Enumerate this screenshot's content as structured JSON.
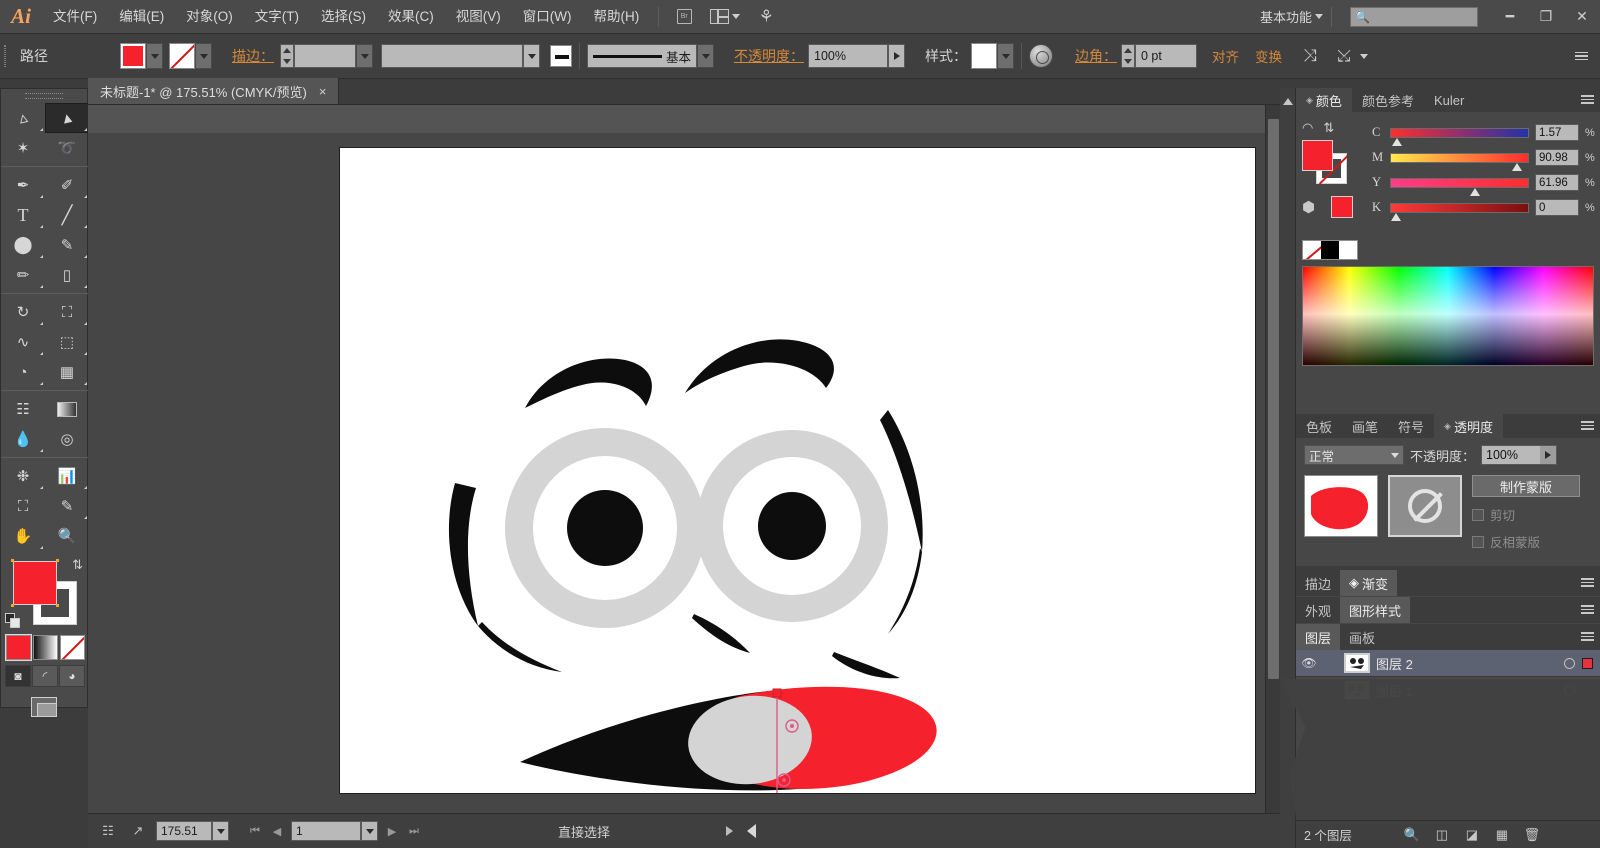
{
  "app": {
    "logo": "Ai",
    "menus": [
      "文件(F)",
      "编辑(E)",
      "对象(O)",
      "文字(T)",
      "选择(S)",
      "效果(C)",
      "视图(V)",
      "窗口(W)",
      "帮助(H)"
    ],
    "bridge_icon": "bridge-icon",
    "arrange_icon": "arrange-documents-icon",
    "workspace": "基本功能",
    "search_placeholder": "",
    "window_buttons": [
      "minimize",
      "restore",
      "close"
    ]
  },
  "control_bar": {
    "selection_label": "路径",
    "fill_label": "fill-swatch",
    "fill_color": "#f5222d",
    "stroke_label": "stroke-swatch",
    "stroke_value": "无",
    "stroke_text": "描边：",
    "stroke_weight": "",
    "stroke_profile": "",
    "brush_preview_name": "基本",
    "opacity_label": "不透明度：",
    "opacity_value": "100%",
    "style_label": "样式：",
    "recolor_icon": "recolor-artwork-icon",
    "corner_label": "边角：",
    "corner_value": "0 pt",
    "align_label": "对齐",
    "transform_label": "变换",
    "isolate_icon": "isolate-selected-icon",
    "hide_icon": "hide-icon",
    "panel_menu": "panel-menu-icon"
  },
  "document": {
    "tab_title": "未标题-1* @ 175.51% (CMYK/预览)",
    "close": "×"
  },
  "toolbox": {
    "tools": [
      {
        "name": "selection-tool",
        "glyph": "↖",
        "active": false
      },
      {
        "name": "direct-selection-tool",
        "glyph": "↖",
        "active": true
      },
      {
        "name": "magic-wand-tool",
        "glyph": "✲",
        "active": false
      },
      {
        "name": "lasso-tool",
        "glyph": "➰",
        "active": false
      },
      {
        "name": "pen-tool",
        "glyph": "✒",
        "active": false
      },
      {
        "name": "add-anchor-point-tool",
        "glyph": "✐",
        "active": false
      },
      {
        "name": "type-tool",
        "glyph": "T",
        "active": false
      },
      {
        "name": "line-segment-tool",
        "glyph": "╱",
        "active": false
      },
      {
        "name": "ellipse-tool",
        "glyph": "●",
        "active": false
      },
      {
        "name": "paintbrush-tool",
        "glyph": "✎",
        "active": false
      },
      {
        "name": "pencil-tool",
        "glyph": "✏",
        "active": false
      },
      {
        "name": "eraser-tool",
        "glyph": "▭",
        "active": false
      },
      {
        "name": "rotate-tool",
        "glyph": "↻",
        "active": false
      },
      {
        "name": "scale-tool",
        "glyph": "↗",
        "active": false
      },
      {
        "name": "width-tool",
        "glyph": "≈",
        "active": false
      },
      {
        "name": "free-transform-tool",
        "glyph": "⬚",
        "active": false
      },
      {
        "name": "shape-builder-tool",
        "glyph": "◔",
        "active": false
      },
      {
        "name": "perspective-grid-tool",
        "glyph": "⬒",
        "active": false
      },
      {
        "name": "mesh-tool",
        "glyph": "⌧",
        "active": false
      },
      {
        "name": "gradient-tool",
        "glyph": "■",
        "active": false
      },
      {
        "name": "eyedropper-tool",
        "glyph": "☂",
        "active": false
      },
      {
        "name": "blend-tool",
        "glyph": "◎",
        "active": false
      },
      {
        "name": "symbol-sprayer-tool",
        "glyph": "❉",
        "active": false
      },
      {
        "name": "column-graph-tool",
        "glyph": "▐",
        "active": false
      },
      {
        "name": "artboard-tool",
        "glyph": "⛶",
        "active": false
      },
      {
        "name": "slice-tool",
        "glyph": "✂",
        "active": false
      },
      {
        "name": "hand-tool",
        "glyph": "✋",
        "active": false
      },
      {
        "name": "zoom-tool",
        "glyph": "⚲",
        "active": false
      }
    ],
    "fill_color": "#f5222d",
    "stroke_color": "#ffffff",
    "swap_icon": "swap-fill-stroke-icon",
    "default_icon": "default-fill-stroke-icon",
    "color_modes": [
      {
        "name": "color-swatch-button",
        "selected": true
      },
      {
        "name": "gradient-swatch-button",
        "selected": false
      },
      {
        "name": "none-swatch-button",
        "selected": false
      }
    ],
    "draw_modes": [
      {
        "name": "draw-normal-button",
        "glyph": "◱",
        "on": true
      },
      {
        "name": "draw-behind-button",
        "glyph": "◴",
        "on": false
      },
      {
        "name": "draw-inside-button",
        "glyph": "◕",
        "on": false
      }
    ],
    "screen_mode": "change-screen-mode-button"
  },
  "color_panel": {
    "tabs": [
      {
        "label": "颜色",
        "active": true
      },
      {
        "label": "颜色参考",
        "active": false
      },
      {
        "label": "Kuler",
        "active": false
      }
    ],
    "sliders": [
      {
        "label": "C",
        "value": "1.57",
        "unit": "%",
        "pos": 2
      },
      {
        "label": "M",
        "value": "90.98",
        "unit": "%",
        "pos": 91
      },
      {
        "label": "Y",
        "value": "61.96",
        "unit": "%",
        "pos": 62
      },
      {
        "label": "K",
        "value": "0",
        "unit": "%",
        "pos": 0
      }
    ],
    "fill_color": "#f5222d",
    "swatch_row": [
      "none",
      "black",
      "white"
    ]
  },
  "transparency_panel": {
    "tabs": [
      {
        "label": "色板",
        "active": false
      },
      {
        "label": "画笔",
        "active": false
      },
      {
        "label": "符号",
        "active": false
      },
      {
        "label": "透明度",
        "active": true
      }
    ],
    "blend_mode": "正常",
    "opacity_label": "不透明度：",
    "opacity_value": "100%",
    "make_mask_button": "制作蒙版",
    "clip_label": "剪切",
    "invert_label": "反相蒙版"
  },
  "stroke_gradient_bar": {
    "tabs": [
      {
        "label": "描边",
        "active": false
      },
      {
        "label": "渐变",
        "active": true
      }
    ]
  },
  "appearance_bar": {
    "tabs": [
      {
        "label": "外观",
        "active": false
      },
      {
        "label": "图形样式",
        "active": true
      }
    ]
  },
  "layers_panel": {
    "tabs": [
      {
        "label": "图层",
        "active": true
      },
      {
        "label": "画板",
        "active": false
      }
    ],
    "rows": [
      {
        "name": "图层 2",
        "visible": true,
        "selected": true,
        "has_color_chip": true
      },
      {
        "name": "图层 1",
        "visible": false,
        "selected": false,
        "has_color_chip": false
      }
    ],
    "footer_count": "2 个图层",
    "footer_icons": [
      "locate-object-icon",
      "make-sublayer-icon",
      "create-new-sublayer-icon",
      "create-new-layer-icon",
      "delete-selection-icon"
    ]
  },
  "status_bar": {
    "zoom_value": "175.51",
    "page_value": "1",
    "status_text": "直接选择",
    "artboard_nav_icons": [
      "first",
      "prev",
      "next",
      "last"
    ],
    "left_icons": [
      "artboard-navigation-icon",
      "export-icon"
    ]
  },
  "artwork": {
    "description": "cartoon-face-eyes-and-mouth",
    "colors": {
      "black": "#0d0d0d",
      "gray": "#d4d4d4",
      "red": "#f5222d",
      "handle": "#e05a8a"
    }
  }
}
